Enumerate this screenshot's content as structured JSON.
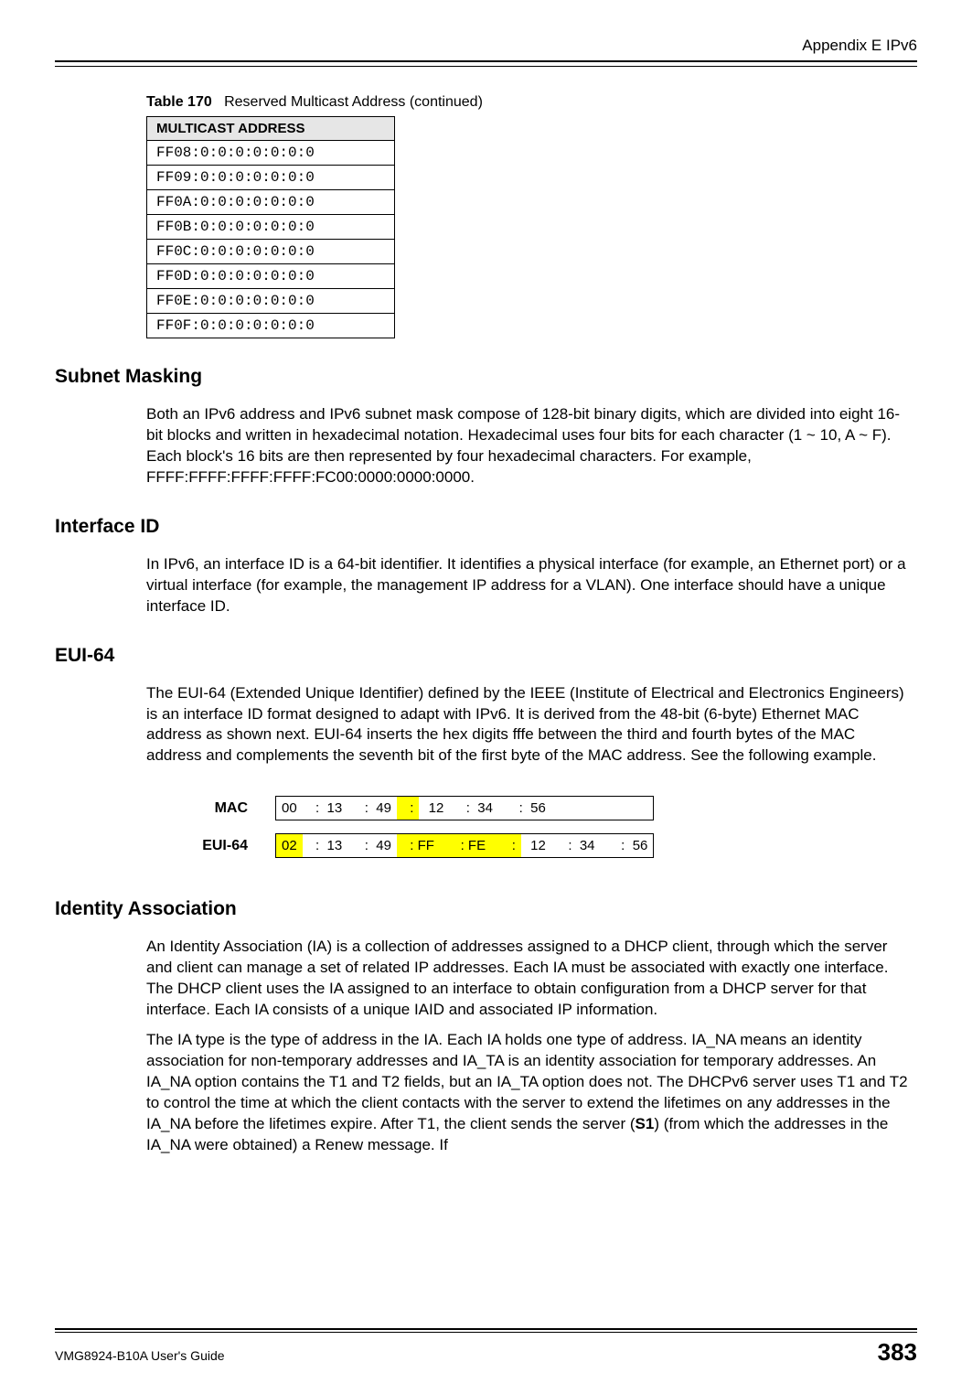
{
  "header": {
    "appendix": "Appendix E IPv6"
  },
  "table170": {
    "caption_label": "Table 170",
    "caption_text": "Reserved Multicast Address (continued)",
    "header": "MULTICAST ADDRESS",
    "rows": [
      "FF08:0:0:0:0:0:0:0",
      "FF09:0:0:0:0:0:0:0",
      "FF0A:0:0:0:0:0:0:0",
      "FF0B:0:0:0:0:0:0:0",
      "FF0C:0:0:0:0:0:0:0",
      "FF0D:0:0:0:0:0:0:0",
      "FF0E:0:0:0:0:0:0:0",
      "FF0F:0:0:0:0:0:0:0"
    ]
  },
  "sections": {
    "subnet_masking": {
      "title": "Subnet Masking",
      "body": "Both an IPv6 address and IPv6 subnet mask compose of 128-bit binary digits, which are divided into eight 16-bit blocks and written in hexadecimal notation. Hexadecimal uses four bits for each character (1 ~ 10, A ~ F). Each block's 16 bits are then represented by four hexadecimal characters. For example, FFFF:FFFF:FFFF:FFFF:FC00:0000:0000:0000."
    },
    "interface_id": {
      "title": "Interface ID",
      "body": "In IPv6, an interface ID is a 64-bit identifier. It identifies a physical interface (for example, an Ethernet port) or a virtual interface (for example, the management IP address for a VLAN). One interface should have a unique interface ID."
    },
    "eui64": {
      "title": "EUI-64",
      "body": "The EUI-64 (Extended Unique Identifier) defined by the IEEE (Institute of Electrical and Electronics Engineers) is an interface ID format designed to adapt with IPv6. It is derived from the 48-bit (6-byte) Ethernet MAC address as shown next. EUI-64 inserts the hex digits fffe between the third and fourth bytes of the MAC address and complements the seventh bit of the first byte of the MAC address. See the following example.",
      "mac_label": "MAC",
      "eui_label": "EUI-64",
      "mac_cells": [
        {
          "t": "00",
          "hl": false
        },
        {
          "t": "  :  13",
          "hl": false
        },
        {
          "t": "   :  49",
          "hl": false
        },
        {
          "t": "  :",
          "hl": true
        },
        {
          "t": " 12",
          "hl": false
        },
        {
          "t": "   :  34",
          "hl": false
        },
        {
          "t": "    :  56",
          "hl": false
        }
      ],
      "eui_cells": [
        {
          "t": "02",
          "hl": true
        },
        {
          "t": "  :  13",
          "hl": false
        },
        {
          "t": "   :  49",
          "hl": false
        },
        {
          "t": "  : FF",
          "hl": true
        },
        {
          "t": "    : FE",
          "hl": true
        },
        {
          "t": "    :",
          "hl": true
        },
        {
          "t": " 12",
          "hl": false
        },
        {
          "t": "   :  34",
          "hl": false
        },
        {
          "t": "    :  56",
          "hl": false
        }
      ]
    },
    "identity_association": {
      "title": "Identity Association",
      "body1": "An Identity Association (IA) is a collection of addresses assigned to a DHCP client, through which the server and client can manage a set of related IP addresses. Each IA must be associated with exactly one interface. The DHCP client uses the IA assigned to an interface to obtain configuration from a DHCP server for that interface. Each IA consists of a unique IAID and associated IP information.",
      "body2_pre": "The IA type is the type of address in the IA. Each IA holds one type of address. IA_NA means an identity association for non-temporary addresses and IA_TA is an identity association for temporary addresses. An IA_NA option contains the T1 and T2 fields, but an IA_TA option does not. The DHCPv6 server uses T1 and T2 to control the time at which the client contacts with the server to extend the lifetimes on any addresses in the IA_NA before the lifetimes expire. After T1, the client sends the server (",
      "body2_bold": "S1",
      "body2_post": ") (from which the addresses in the IA_NA were obtained) a Renew message. If"
    }
  },
  "footer": {
    "guide": "VMG8924-B10A User's Guide",
    "page": "383"
  }
}
